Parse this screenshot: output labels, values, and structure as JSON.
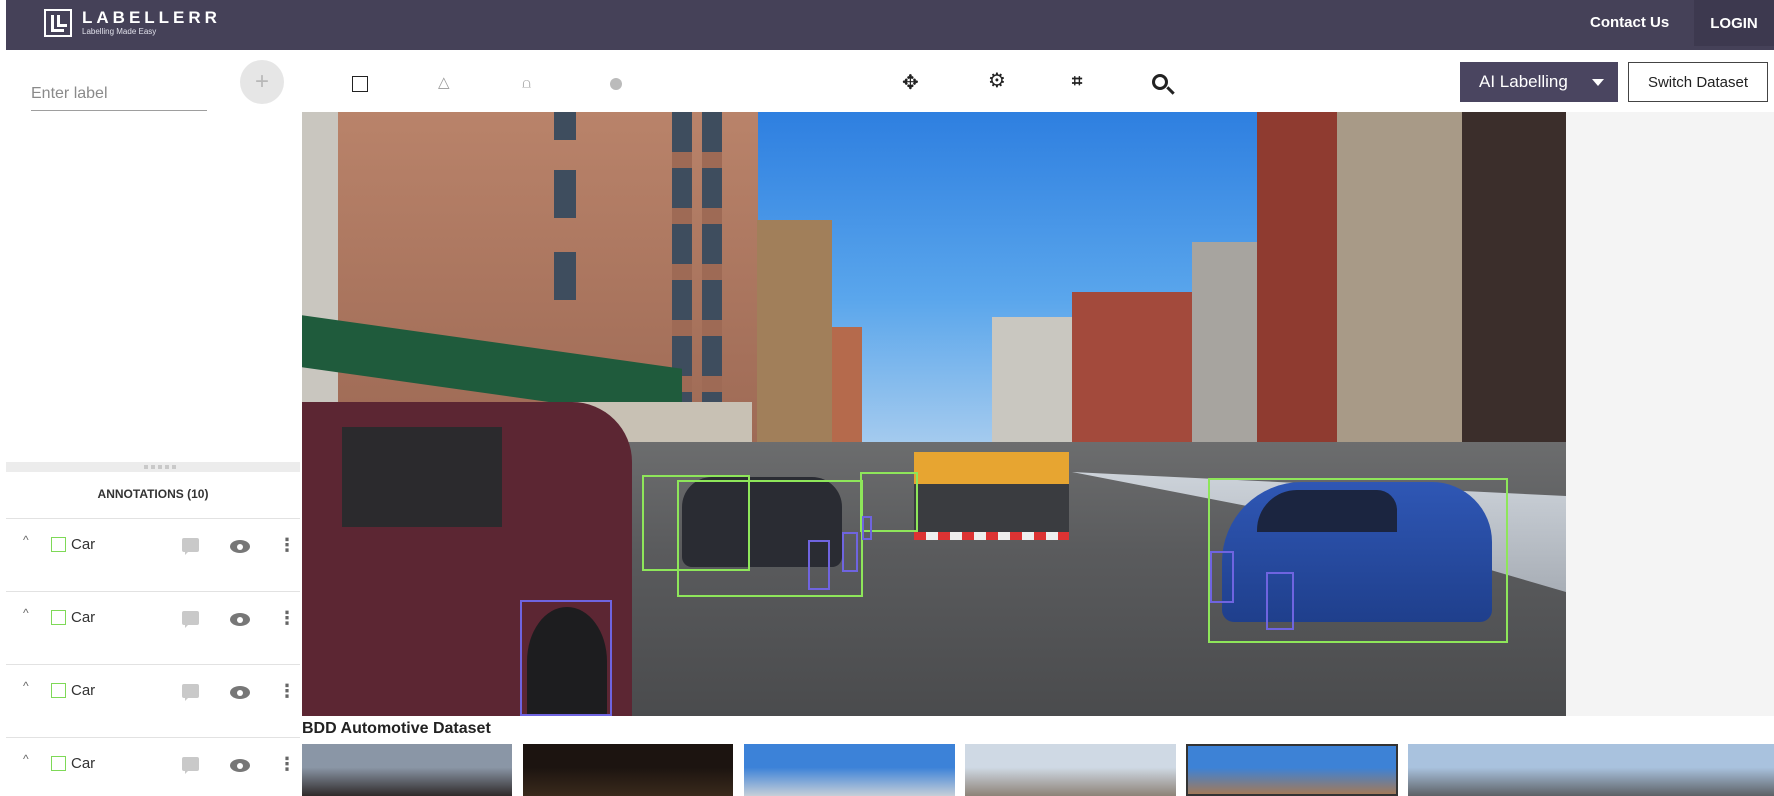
{
  "header": {
    "brand": "LABELLERR",
    "tagline": "Labelling Made Easy",
    "contact_label": "Contact Us",
    "login_label": "LOGIN"
  },
  "label_panel": {
    "input_placeholder": "Enter label",
    "add_label": "+"
  },
  "annotations": {
    "title": "ANNOTATIONS (10)",
    "items": [
      {
        "label": "Car",
        "color": "#7ed957"
      },
      {
        "label": "Car",
        "color": "#7ed957"
      },
      {
        "label": "Car",
        "color": "#7ed957"
      },
      {
        "label": "Car",
        "color": "#7ed957"
      }
    ]
  },
  "toolbar": {
    "tools": [
      "rectangle-icon",
      "polygon-icon",
      "polyline-icon",
      "point-icon",
      "move-icon",
      "settings-icon",
      "crop-icon",
      "zoom-in-icon"
    ],
    "ai_labelling_label": "AI Labelling",
    "switch_dataset_label": "Switch Dataset"
  },
  "canvas": {
    "box_colors": {
      "car": "#8ee65a",
      "person": "#6f64e0"
    }
  },
  "dataset": {
    "title": "BDD Automotive Dataset",
    "thumbnails": [
      {
        "name": "thumb-1",
        "sky": "#8a96a6",
        "ground": "#2f2a2a"
      },
      {
        "name": "thumb-2",
        "sky": "#1c1410",
        "ground": "#3a2a1c"
      },
      {
        "name": "thumb-3",
        "sky": "#3c82d8",
        "ground": "#c6cfd8"
      },
      {
        "name": "thumb-4",
        "sky": "#cfd9e4",
        "ground": "#8d8277"
      },
      {
        "name": "thumb-5",
        "sky": "#3d82d6",
        "ground": "#a27a5a"
      },
      {
        "name": "thumb-6",
        "sky": "#a9c2de",
        "ground": "#5d6166"
      }
    ]
  }
}
